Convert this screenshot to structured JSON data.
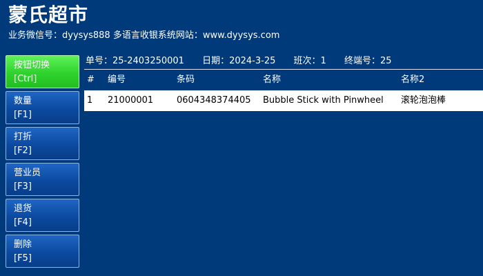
{
  "header": {
    "store_name": "蒙氏超市",
    "subtitle": "业务微信号：dyysys888 多语言收银系统网站：www.dyysys.com"
  },
  "sidebar": {
    "buttons": [
      {
        "label": "按钮切换",
        "key": "[Ctrl]",
        "active": true
      },
      {
        "label": "数量",
        "key": "[F1]",
        "active": false
      },
      {
        "label": "打折",
        "key": "[F2]",
        "active": false
      },
      {
        "label": "营业员",
        "key": "[F3]",
        "active": false
      },
      {
        "label": "退货",
        "key": "[F4]",
        "active": false
      },
      {
        "label": "删除",
        "key": "[F5]",
        "active": false
      }
    ]
  },
  "info": {
    "order_no": "单号：25-2403250001",
    "date": "日期：2024-3-25",
    "shift": "班次：1",
    "terminal": "终端号：25"
  },
  "table": {
    "columns": [
      "#",
      "编号",
      "条码",
      "名称",
      "名称2"
    ],
    "rows": [
      [
        "1",
        "21000001",
        "0604348374405",
        "Bubble Stick with Pinwheel",
        "滚轮泡泡棒"
      ]
    ]
  },
  "colors": {
    "background": "#003a7a",
    "button_blue": "#0b4aa0",
    "button_active_green": "#2fd22c",
    "row_background": "#ffffff"
  }
}
